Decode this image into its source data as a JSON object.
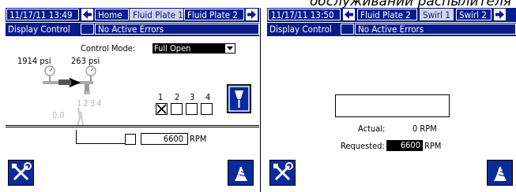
{
  "caption": "обслуживании распылителя",
  "left": {
    "datetime": "11/17/11 13:49",
    "tabs": [
      "Home",
      "Fluid Plate 1",
      "Fluid Plate 2"
    ],
    "active_tab": "Fluid Plate 1",
    "screen_name": "Display Control",
    "error_status": "No Active Errors",
    "control_mode_label": "Control Mode:",
    "control_mode_value": "Full Open",
    "pressure_left": "1914 psi",
    "pressure_right": "263 psi",
    "valve_numbers_grey": "1 2 3 4",
    "flow_grey": "0.0",
    "checkbox_numbers": [
      "1",
      "2",
      "3",
      "4"
    ],
    "checkbox_checked": [
      true,
      false,
      false,
      false
    ],
    "speed_value": "6600",
    "speed_unit": "RPM"
  },
  "right": {
    "datetime": "11/17/11 13:50",
    "tabs": [
      "Fluid Plate 2",
      "Swirl 1",
      "Swirl 2"
    ],
    "active_tab": "Swirl 1",
    "screen_name": "Display Control",
    "error_status": "No Active Errors",
    "input_value": "",
    "actual_label": "Actual:",
    "actual_value": "0 RPM",
    "requested_label": "Requested:",
    "requested_value": "6600",
    "requested_unit": "RPM"
  },
  "colors": {
    "bar_blue": "#0a1b8c",
    "active_tab": "#cfd3e8",
    "button_blue": "#0a2b9a"
  }
}
